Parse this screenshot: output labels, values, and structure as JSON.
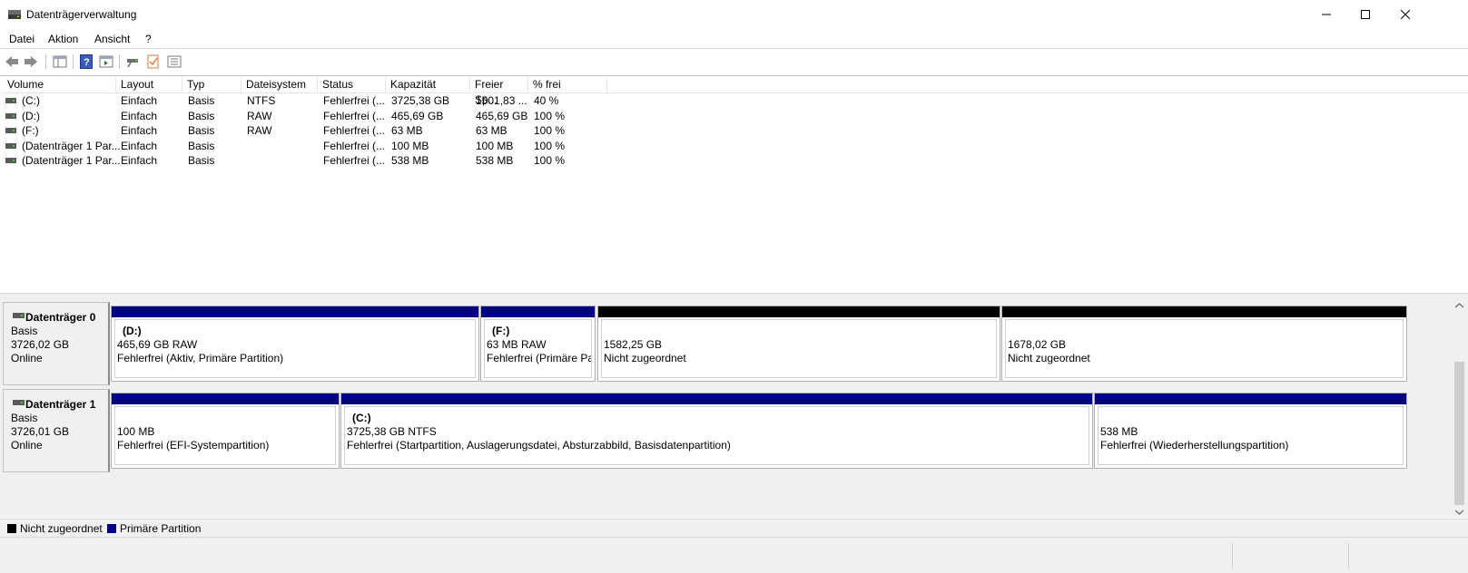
{
  "window": {
    "title": "Datenträgerverwaltung"
  },
  "menu": [
    "Datei",
    "Aktion",
    "Ansicht",
    "?"
  ],
  "toolbar": {
    "icons": [
      "back-icon",
      "forward-icon",
      "console-tree-icon",
      "help-icon",
      "properties-icon",
      "connect-icon",
      "check-icon",
      "list-icon"
    ]
  },
  "volumes": {
    "columns": [
      "Volume",
      "Layout",
      "Typ",
      "Dateisystem",
      "Status",
      "Kapazität",
      "Freier Sp...",
      "% frei"
    ],
    "rows": [
      [
        "(C:)",
        "Einfach",
        "Basis",
        "NTFS",
        "Fehlerfrei (...",
        "3725,38 GB",
        "1501,83 ...",
        "40 %"
      ],
      [
        "(D:)",
        "Einfach",
        "Basis",
        "RAW",
        "Fehlerfrei (...",
        "465,69 GB",
        "465,69 GB",
        "100 %"
      ],
      [
        "(F:)",
        "Einfach",
        "Basis",
        "RAW",
        "Fehlerfrei (...",
        "63 MB",
        "63 MB",
        "100 %"
      ],
      [
        "(Datenträger 1 Par...",
        "Einfach",
        "Basis",
        "",
        "Fehlerfrei (...",
        "100 MB",
        "100 MB",
        "100 %"
      ],
      [
        "(Datenträger 1 Par...",
        "Einfach",
        "Basis",
        "",
        "Fehlerfrei (...",
        "538 MB",
        "538 MB",
        "100 %"
      ]
    ]
  },
  "disks": [
    {
      "name": "Datenträger 0",
      "type": "Basis",
      "size": "3726,02 GB",
      "state": "Online",
      "partitions": [
        {
          "name": "(D:)",
          "size": "465,69 GB RAW",
          "status": "Fehlerfrei (Aktiv, Primäre Partition)",
          "kind": "primary"
        },
        {
          "name": "(F:)",
          "size": "63 MB RAW",
          "status": "Fehlerfrei (Primäre Par",
          "kind": "primary"
        },
        {
          "name": "",
          "size": "1582,25 GB",
          "status": "Nicht zugeordnet",
          "kind": "unallocated"
        },
        {
          "name": "",
          "size": "1678,02 GB",
          "status": "Nicht zugeordnet",
          "kind": "unallocated"
        }
      ]
    },
    {
      "name": "Datenträger 1",
      "type": "Basis",
      "size": "3726,01 GB",
      "state": "Online",
      "partitions": [
        {
          "name": "",
          "size": "100 MB",
          "status": "Fehlerfrei (EFI-Systempartition)",
          "kind": "primary"
        },
        {
          "name": "(C:)",
          "size": "3725,38 GB NTFS",
          "status": "Fehlerfrei (Startpartition, Auslagerungsdatei, Absturzabbild, Basisdatenpartition)",
          "kind": "primary"
        },
        {
          "name": "",
          "size": "538 MB",
          "status": "Fehlerfrei (Wiederherstellungspartition)",
          "kind": "primary"
        }
      ]
    }
  ],
  "legend": [
    {
      "label": "Nicht zugeordnet",
      "color": "#000000"
    },
    {
      "label": "Primäre Partition",
      "color": "#00008b"
    }
  ],
  "colors": {
    "primary": "#000080",
    "unallocated": "#000000"
  }
}
